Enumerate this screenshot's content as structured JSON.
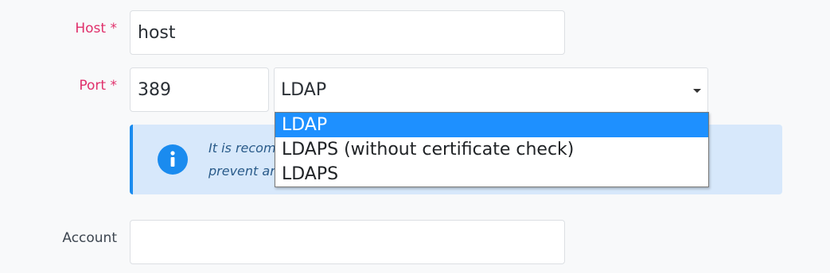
{
  "form": {
    "host": {
      "label": "Host *",
      "value": "host"
    },
    "port": {
      "label": "Port *",
      "value": "389",
      "protocol_value": "LDAP",
      "options": [
        "LDAP",
        "LDAPS (without certificate check)",
        "LDAPS"
      ],
      "highlighted_option": "LDAP"
    },
    "info": {
      "text": "It is recom                                                                                              eck to\nprevent ar"
    },
    "account": {
      "label": "Account",
      "value": ""
    }
  },
  "colors": {
    "required_label": "#e0306b",
    "info_background": "#d7e8fb",
    "info_accent": "#1a8bef",
    "selected_option": "#1e90ff"
  },
  "icons": {
    "info": "info-circle-icon",
    "caret": "caret-down-icon"
  }
}
